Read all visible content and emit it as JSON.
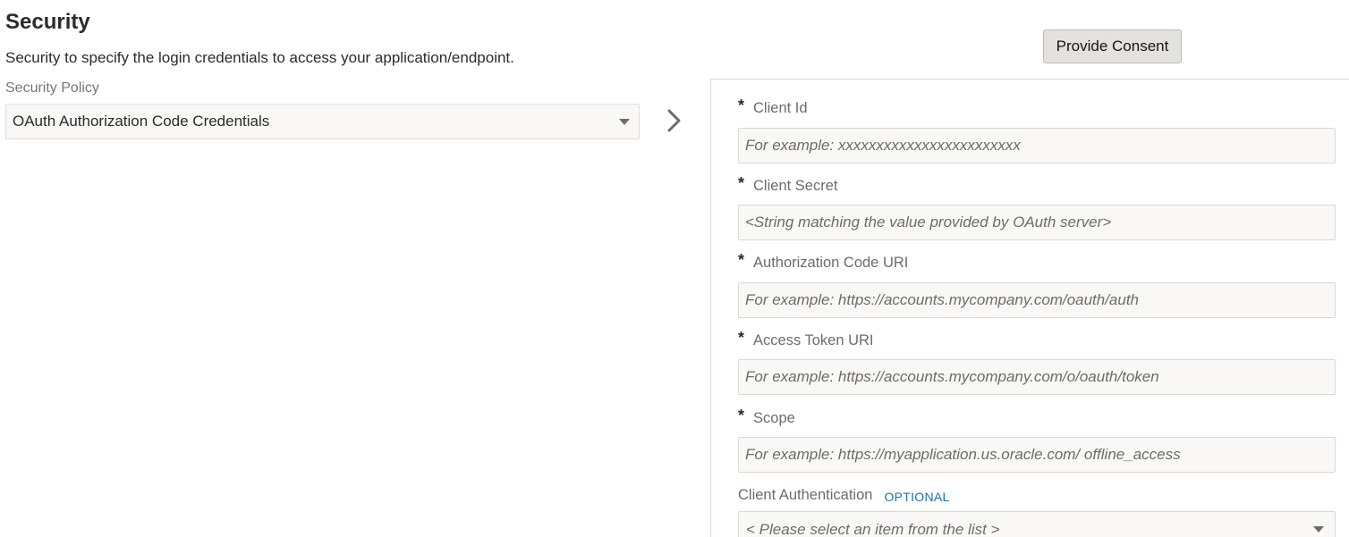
{
  "section": {
    "title": "Security",
    "description": "Security to specify the login credentials to access your application/endpoint."
  },
  "policy": {
    "label": "Security Policy",
    "selected": "OAuth Authorization Code Credentials"
  },
  "consent_button": "Provide Consent",
  "fields": {
    "client_id": {
      "required_mark": "*",
      "label": "Client Id",
      "placeholder": "For example: xxxxxxxxxxxxxxxxxxxxxxxx"
    },
    "client_secret": {
      "required_mark": "*",
      "label": "Client Secret",
      "placeholder": "<String matching the value provided by OAuth server>"
    },
    "auth_code_uri": {
      "required_mark": "*",
      "label": "Authorization Code URI",
      "placeholder": "For example: https://accounts.mycompany.com/oauth/auth"
    },
    "access_token_uri": {
      "required_mark": "*",
      "label": "Access Token URI",
      "placeholder": "For example: https://accounts.mycompany.com/o/oauth/token"
    },
    "scope": {
      "required_mark": "*",
      "label": "Scope",
      "placeholder": "For example: https://myapplication.us.oracle.com/ offline_access"
    },
    "client_auth": {
      "label": "Client Authentication",
      "optional_tag": "OPTIONAL",
      "placeholder": "< Please select an item from the list >"
    }
  },
  "icons": {
    "expand": "chevron-right-icon",
    "dropdown": "caret-down-icon"
  },
  "colors": {
    "optional_tag": "#1a73ad",
    "field_background": "#f9f8f6",
    "button_background": "#e4e2df"
  }
}
